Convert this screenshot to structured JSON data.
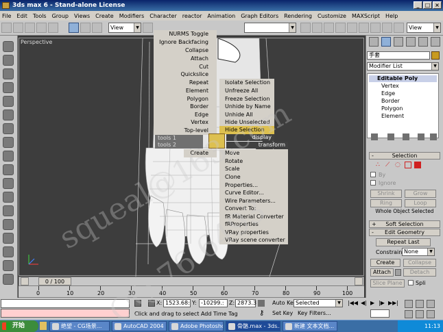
{
  "title": "3ds max 6 - Stand-alone License",
  "menu": [
    "File",
    "Edit",
    "Tools",
    "Group",
    "Views",
    "Create",
    "Modifiers",
    "Character",
    "reactor",
    "Animation",
    "Graph Editors",
    "Rendering",
    "Customize",
    "MAXScript",
    "Help"
  ],
  "toolbar": {
    "view_select": "View",
    "view_select2": "View"
  },
  "viewport": {
    "label": "Perspective"
  },
  "quad": {
    "left_top": [
      "NURMS Toggle",
      "Ignore Backfacing",
      "Collapse",
      "Attach",
      "Cut",
      "Quickslice",
      "Repeat",
      "Element",
      "Polygon",
      "Border",
      "Edge",
      "Vertex",
      "Top-level"
    ],
    "right_top": [
      "Isolate Selection",
      "Unfreeze All",
      "Freeze Selection",
      "Unhide by Name",
      "Unhide All",
      "Hide Unselected",
      "Hide Selection"
    ],
    "display_title": "display",
    "transform_title": "transform",
    "tools1_title": "tools 1",
    "tools2_title": "tools 2",
    "left_bottom": [
      "Create"
    ],
    "right_bottom": [
      "Move",
      "Rotate",
      "Scale",
      "Clone",
      "Properties...",
      "Curve Editor...",
      "Wire Parameters...",
      "Convert To:",
      "fR Material Converter",
      "fRProperties",
      "VRay properties",
      "VRay scene converter"
    ]
  },
  "cmdpanel": {
    "object_name": "手套",
    "modifier_list": "Modifier List",
    "stack_root": "Editable Poly",
    "stack_items": [
      "Vertex",
      "Edge",
      "Border",
      "Polygon",
      "Element"
    ],
    "selection_title": "Selection",
    "by": "By",
    "ignore": "Ignore",
    "shrink": "Shrink",
    "grow": "Grow",
    "ring": "Ring",
    "loop": "Loop",
    "whole_object": "Whole Object Selected",
    "soft_title": "Soft Selection",
    "edit_geo_title": "Edit Geometry",
    "repeat_last": "Repeat Last",
    "constraints_label": "Constraints",
    "constraints_value": "None",
    "create": "Create",
    "collapse": "Collapse",
    "attach": "Attach",
    "detach": "Detach",
    "slice_plane": "Slice Plane",
    "split": "Spli"
  },
  "timeline": {
    "frame": "0 / 100",
    "ticks": [
      "0",
      "10",
      "20",
      "30",
      "40",
      "50",
      "60",
      "70",
      "80",
      "90",
      "100"
    ]
  },
  "status": {
    "x_label": "X:",
    "x_value": "1523.68:",
    "y_label": "Y:",
    "y_value": "-10299.:",
    "z_label": "Z:",
    "z_value": "2873.3",
    "autokey": "Auto Key",
    "selected": "Selected",
    "setkey": "Set Key",
    "keyfilters": "Key Filters...",
    "prompt": "Click and drag to select Add Time Tag"
  },
  "taskbar": {
    "start": "开始",
    "tasks": [
      "绝望 - CG场景...",
      "AutoCAD 2004 ...",
      "Adobe Photoshop",
      "骨骼.max - 3ds...",
      "新建 文本文档..."
    ],
    "time": "11:13"
  },
  "watermark": {
    "line1": "squeal@163.com",
    "line2": "QQ:76 6493"
  }
}
